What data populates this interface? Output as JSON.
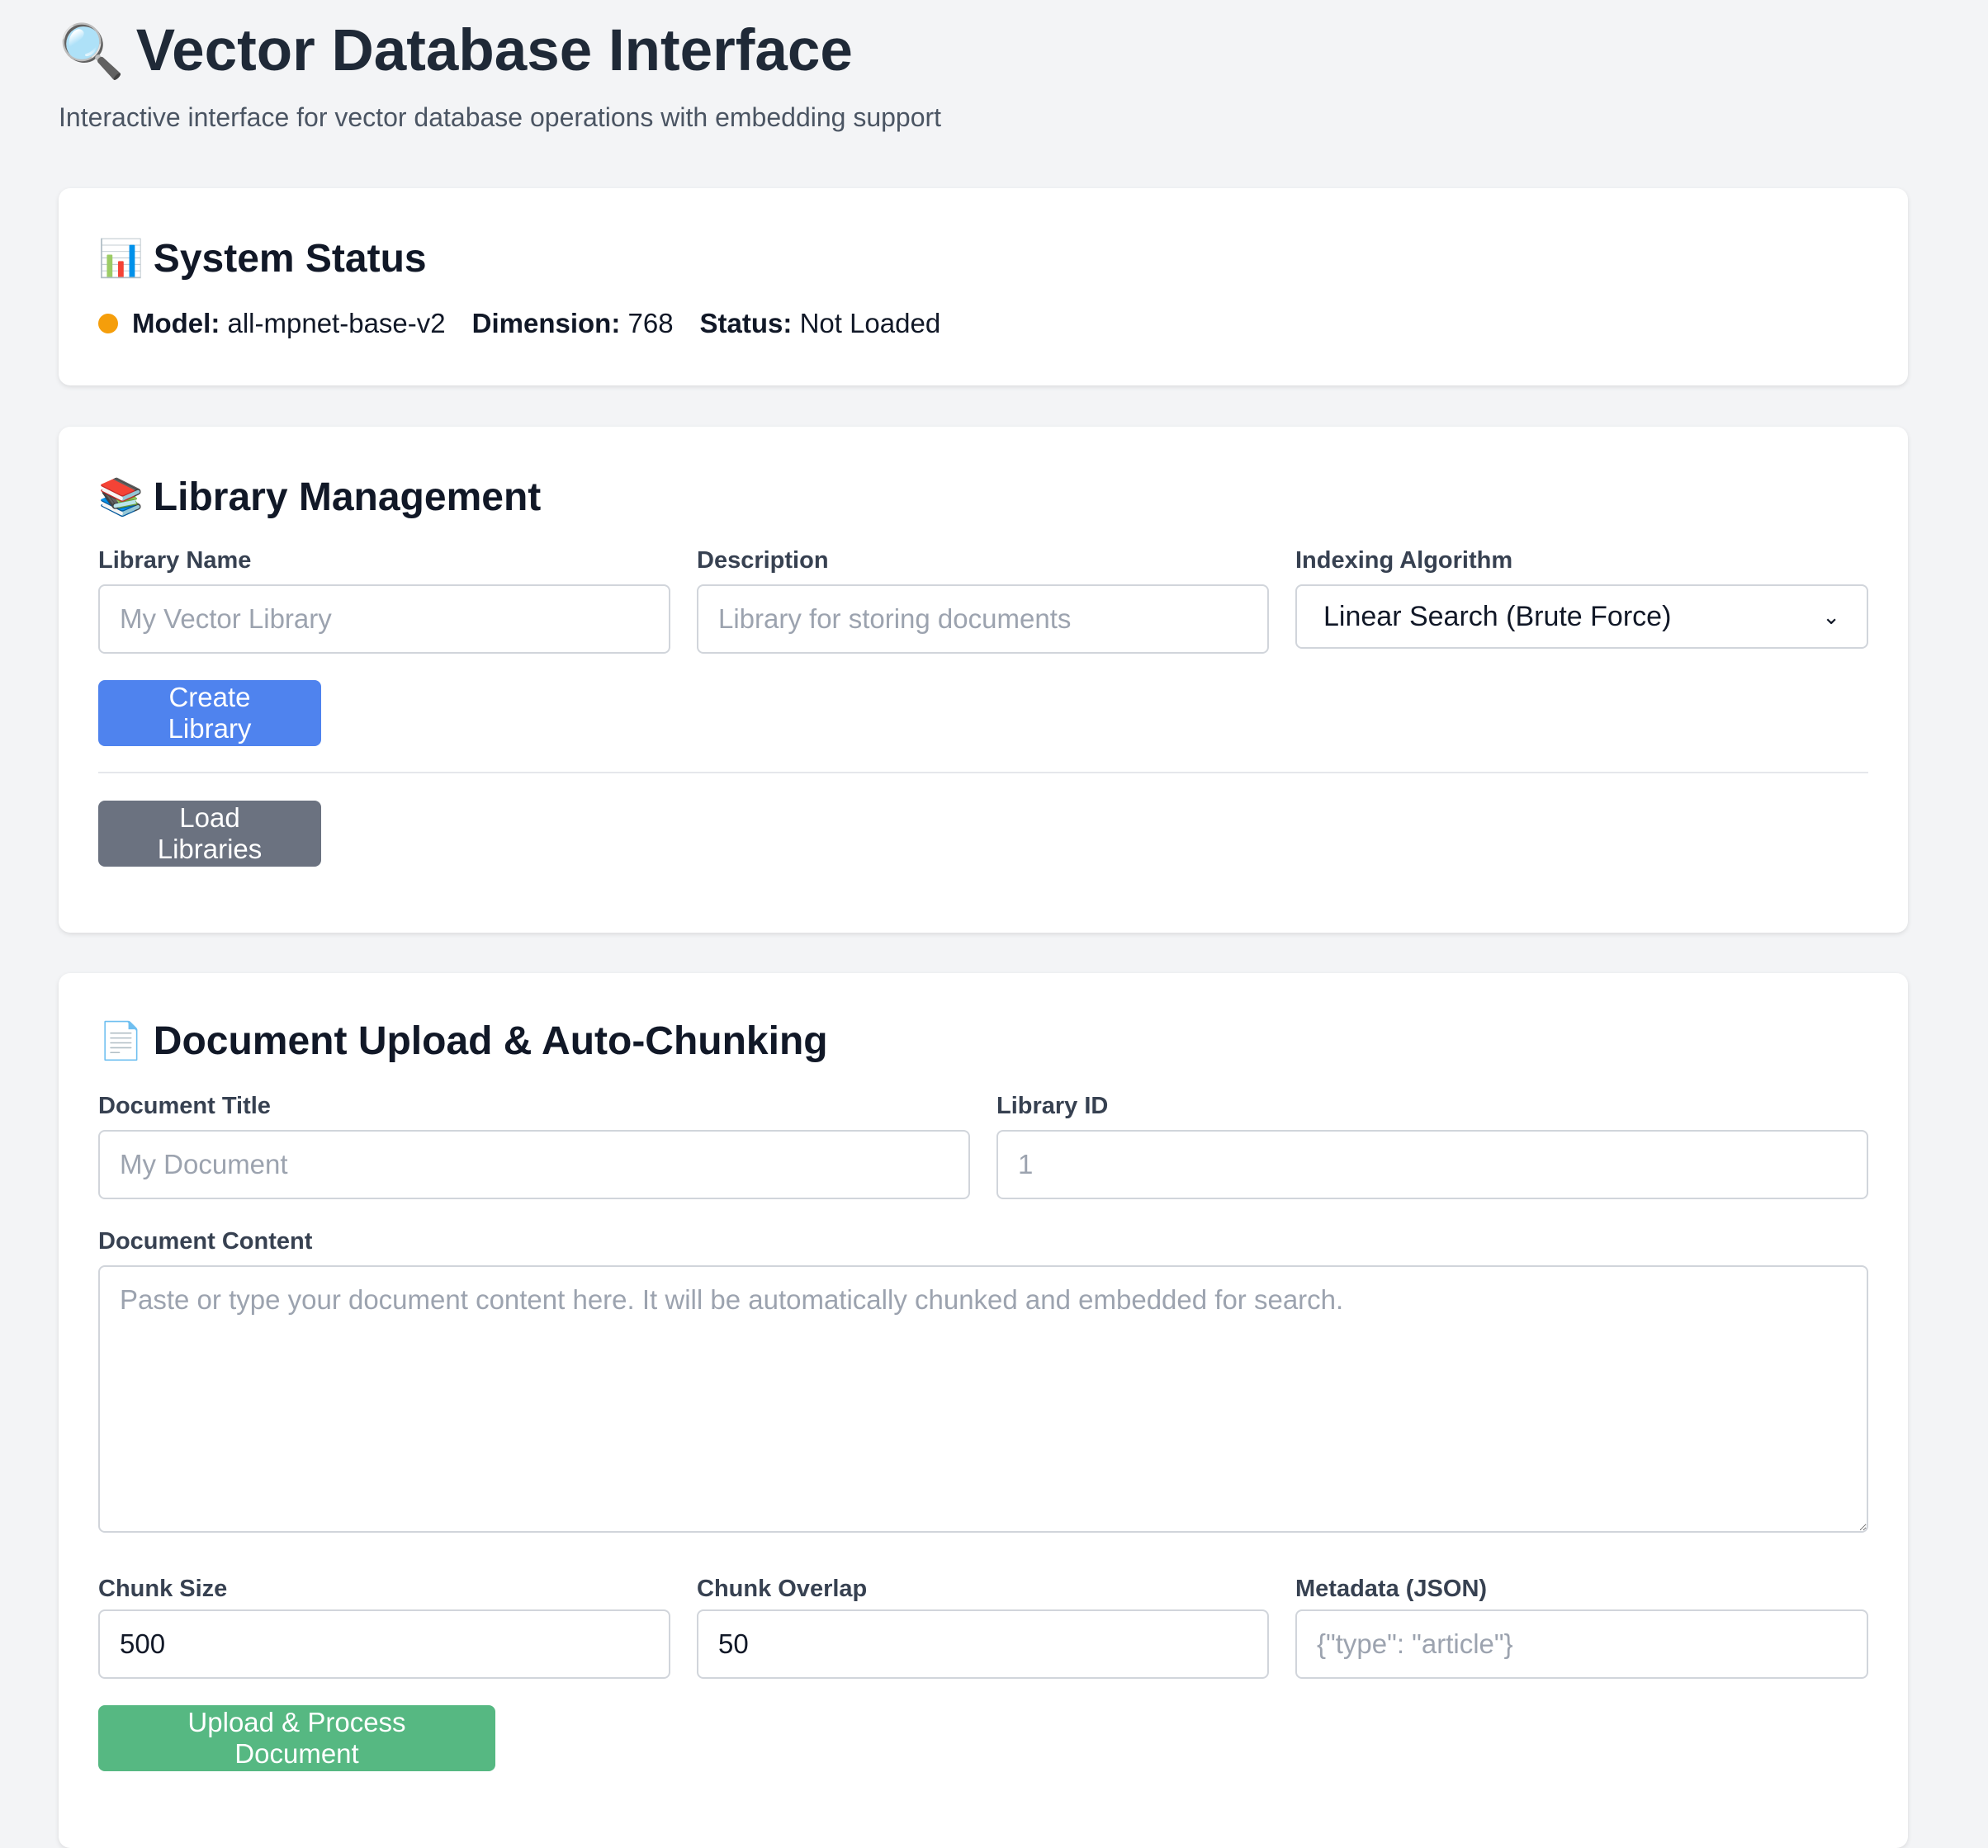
{
  "header": {
    "icon": "🔍",
    "title": "Vector Database Interface",
    "subtitle": "Interactive interface for vector database operations with embedding support"
  },
  "system_status": {
    "icon": "📊",
    "title": "System Status",
    "indicator_color": "#f59e0b",
    "model_label": "Model:",
    "model_value": "all-mpnet-base-v2",
    "dimension_label": "Dimension:",
    "dimension_value": "768",
    "status_label": "Status:",
    "status_value": "Not Loaded"
  },
  "library_management": {
    "icon": "📚",
    "title": "Library Management",
    "name_label": "Library Name",
    "name_placeholder": "My Vector Library",
    "description_label": "Description",
    "description_placeholder": "Library for storing documents",
    "algorithm_label": "Indexing Algorithm",
    "algorithm_selected": "Linear Search (Brute Force)",
    "create_button": "Create Library",
    "load_button": "Load Libraries"
  },
  "document_upload": {
    "icon": "📄",
    "title": "Document Upload & Auto-Chunking",
    "title_label": "Document Title",
    "title_placeholder": "My Document",
    "library_id_label": "Library ID",
    "library_id_placeholder": "1",
    "content_label": "Document Content",
    "content_placeholder": "Paste or type your document content here. It will be automatically chunked and embedded for search.",
    "chunk_size_label": "Chunk Size",
    "chunk_size_value": "500",
    "chunk_overlap_label": "Chunk Overlap",
    "chunk_overlap_value": "50",
    "metadata_label": "Metadata (JSON)",
    "metadata_placeholder": "{\"type\": \"article\"}",
    "upload_button": "Upload & Process Document"
  },
  "colors": {
    "primary_blue": "#4f83ee",
    "secondary_gray": "#6b7280",
    "success_green": "#56b882",
    "background": "#f3f4f6"
  }
}
